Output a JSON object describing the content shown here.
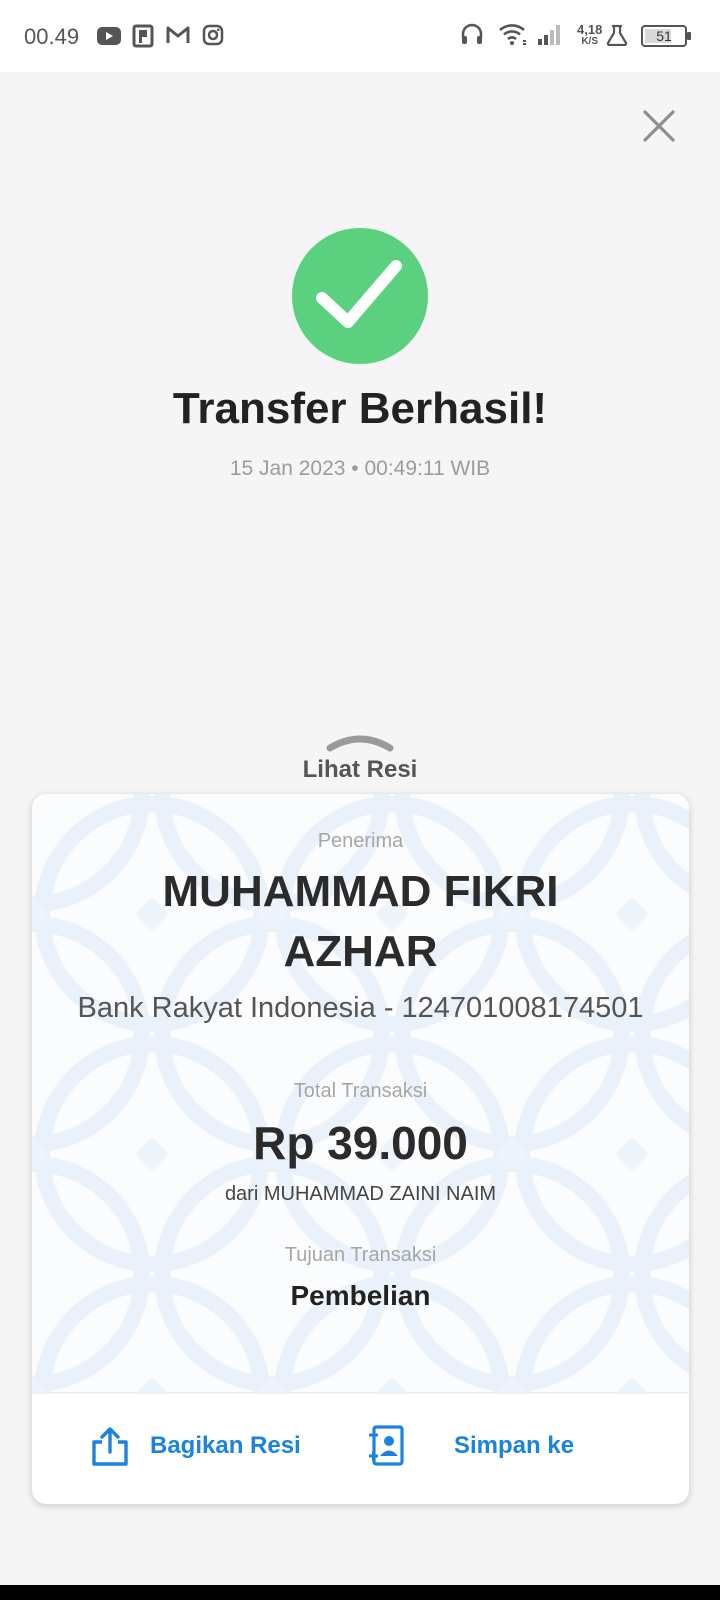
{
  "status_bar": {
    "time": "00.49",
    "net_speed_value": "4,18",
    "net_speed_unit": "K/S",
    "battery": "51",
    "icons": [
      "youtube-icon",
      "app-p-icon",
      "gmail-icon",
      "instagram-icon",
      "headset-icon",
      "wifi-icon",
      "signal-icon",
      "flask-icon",
      "battery-icon"
    ]
  },
  "header": {
    "title": "Transfer Berhasil!",
    "datetime": "15 Jan 2023 • 00:49:11 WIB"
  },
  "receipt_toggle": {
    "label": "Lihat Resi"
  },
  "receipt": {
    "recipient_label": "Penerima",
    "recipient_name_line1": "MUHAMMAD FIKRI",
    "recipient_name_line2": "AZHAR",
    "recipient_bank": "Bank Rakyat Indonesia - 124701008174501",
    "total_label": "Total Transaksi",
    "total_amount": "Rp 39.000",
    "sender": "dari MUHAMMAD ZAINI NAIM",
    "purpose_label": "Tujuan Transaksi",
    "purpose_value": "Pembelian"
  },
  "actions": {
    "share_label": "Bagikan Resi",
    "save_label": "Simpan ke"
  },
  "colors": {
    "success": "#5bd07e",
    "accent": "#1a82e2",
    "background": "#f5f5f5"
  }
}
